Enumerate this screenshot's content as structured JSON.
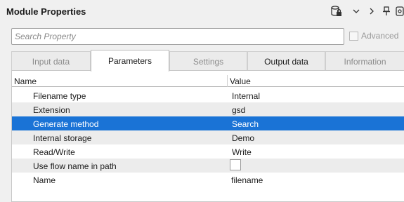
{
  "panel": {
    "title": "Module Properties",
    "toolbar_icons": [
      "database-lock-icon",
      "chevron-down-icon",
      "chevron-right-icon",
      "pin-icon",
      "settings-icon"
    ]
  },
  "search": {
    "placeholder": "Search Property",
    "value": ""
  },
  "advanced": {
    "label": "Advanced",
    "checked": false
  },
  "tabs": [
    {
      "label": "Input data",
      "active": false
    },
    {
      "label": "Parameters",
      "active": true
    },
    {
      "label": "Settings",
      "active": false
    },
    {
      "label": "Output data",
      "active": false
    },
    {
      "label": "Information",
      "active": false
    }
  ],
  "table": {
    "columns": [
      "Name",
      "Value"
    ],
    "rows": [
      {
        "name": "Filename type",
        "value": "Internal"
      },
      {
        "name": "Extension",
        "value": "gsd"
      },
      {
        "name": "Generate method",
        "value": "Search",
        "selected": true
      },
      {
        "name": "Internal storage",
        "value": "Demo"
      },
      {
        "name": "Read/Write",
        "value": "Write"
      },
      {
        "name": "Use flow name in path",
        "value": "",
        "checkbox": false
      },
      {
        "name": "Name",
        "value": "filename"
      }
    ]
  },
  "colors": {
    "selection": "#1a73d6",
    "alt_row": "#ececec"
  }
}
